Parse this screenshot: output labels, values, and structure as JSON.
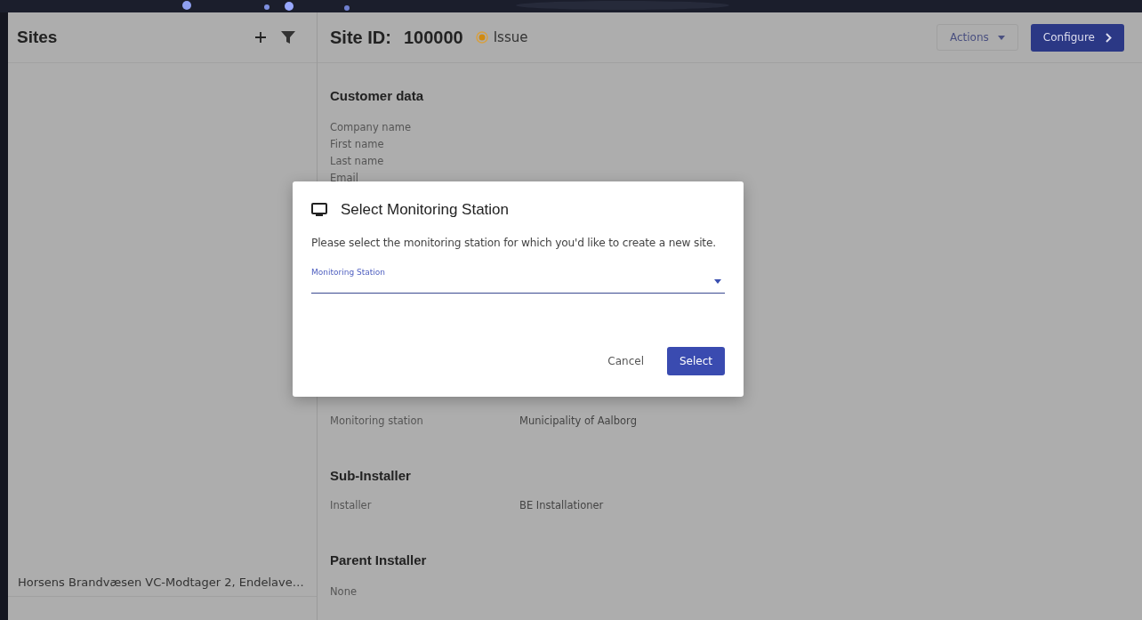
{
  "sidebar": {
    "title": "Sites",
    "items": [
      {
        "label": "Horsens Brandvæsen VC-Modtager 2, Endelave…"
      }
    ]
  },
  "header": {
    "site_id_label": "Site ID:",
    "site_id": "100000",
    "status": "Issue",
    "actions": "Actions",
    "configure": "Configure"
  },
  "sections": [
    {
      "title": "Customer data",
      "rows": [
        {
          "label": "Company name"
        },
        {
          "label": "First name"
        },
        {
          "label": "Last name"
        },
        {
          "label": "Email"
        }
      ]
    },
    {
      "rows": [
        {
          "label": "Monitoring station",
          "value": "Municipality of Aalborg"
        }
      ]
    },
    {
      "title": "Sub-Installer",
      "rows": [
        {
          "label": "Installer",
          "value": "BE Installationer"
        }
      ]
    },
    {
      "title": "Parent Installer",
      "rows": [
        {
          "label": "None"
        }
      ]
    }
  ],
  "dialog": {
    "title": "Select Monitoring Station",
    "message": "Please select the monitoring station for which you'd like to create a new site.",
    "field_label": "Monitoring Station",
    "buttons": [
      {
        "label": "Cancel",
        "kind": "text"
      },
      {
        "label": "Select",
        "kind": "primary"
      }
    ]
  }
}
